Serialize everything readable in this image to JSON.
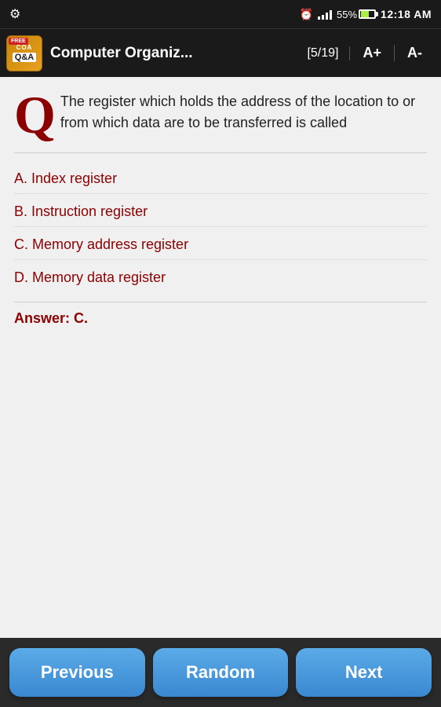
{
  "status_bar": {
    "time": "12:18 AM",
    "battery_percent": "55%"
  },
  "app_bar": {
    "title": "Computer Organiz...",
    "counter": "[5/19]",
    "font_increase": "A+",
    "font_decrease": "A-",
    "icon_free": "FREE",
    "icon_coa": "COA",
    "icon_qa": "Q&A"
  },
  "question": {
    "q_letter": "Q",
    "text": "The register which holds the address of the location to or from which data are to be transferred is called"
  },
  "options": [
    {
      "label": "A. Index register"
    },
    {
      "label": "B. Instruction register"
    },
    {
      "label": "C. Memory address register"
    },
    {
      "label": "D. Memory data register"
    }
  ],
  "answer": {
    "text": "Answer: C."
  },
  "nav": {
    "previous": "Previous",
    "random": "Random",
    "next": "Next"
  }
}
